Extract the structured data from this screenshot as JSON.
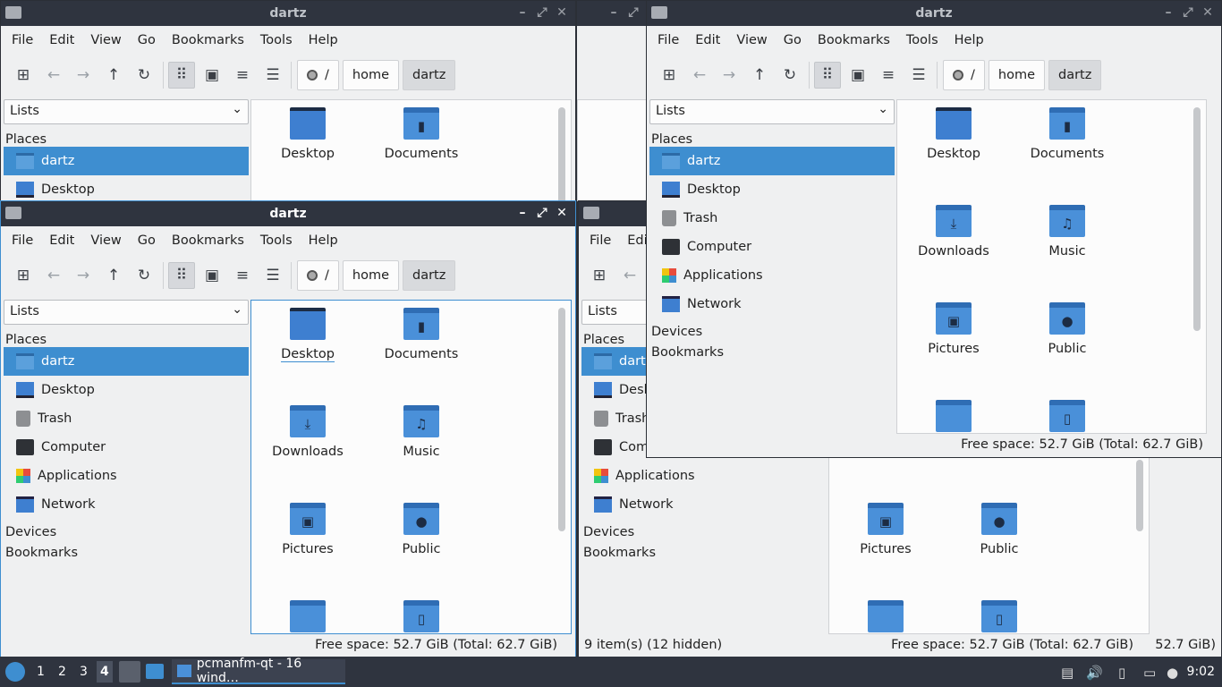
{
  "window_title": "dartz",
  "menu": [
    "File",
    "Edit",
    "View",
    "Go",
    "Bookmarks",
    "Tools",
    "Help"
  ],
  "path": {
    "root": "/",
    "segments": [
      "home",
      "dartz"
    ]
  },
  "side_combo": "Lists",
  "places_header": "Places",
  "places": [
    {
      "label": "dartz",
      "icon": "home-folder-icon"
    },
    {
      "label": "Desktop",
      "icon": "desktop-icon"
    },
    {
      "label": "Trash",
      "icon": "trash-icon"
    },
    {
      "label": "Computer",
      "icon": "computer-icon"
    },
    {
      "label": "Applications",
      "icon": "applications-icon"
    },
    {
      "label": "Network",
      "icon": "network-icon"
    }
  ],
  "devices_header": "Devices",
  "bookmarks_header": "Bookmarks",
  "files": [
    {
      "label": "Desktop",
      "icon": "desktop-folder-icon"
    },
    {
      "label": "Documents",
      "icon": "documents-folder-icon"
    },
    {
      "label": "Downloads",
      "icon": "downloads-folder-icon"
    },
    {
      "label": "Music",
      "icon": "music-folder-icon"
    },
    {
      "label": "Pictures",
      "icon": "pictures-folder-icon"
    },
    {
      "label": "Public",
      "icon": "public-folder-icon"
    }
  ],
  "status": {
    "free_space": "Free space: 52.7 GiB (Total: 62.7 GiB)",
    "items": "9 item(s) (12 hidden)",
    "free_space_clipped": "52.7 GiB)"
  },
  "partial": {
    "menu_file": "File",
    "menu_edit": "Edi",
    "dartz": "dartz",
    "desktop": "Desk",
    "trash": "Trash",
    "computer": "Comp",
    "applications": "Applications",
    "network": "Network",
    "devices": "Devices",
    "bookmarks": "Bookmarks",
    "pictures": "Pictures",
    "public": "Public",
    "lists": "Lists",
    "places": "Places"
  },
  "taskbar": {
    "workspaces": [
      "1",
      "2",
      "3",
      "4"
    ],
    "current_workspace": "4",
    "task_label": "pcmanfm-qt - 16 wind…",
    "clock": "9:02"
  },
  "colors": {
    "accent": "#3e8ed0",
    "titlebar": "#2f343f",
    "window_bg": "#eff0f1"
  }
}
